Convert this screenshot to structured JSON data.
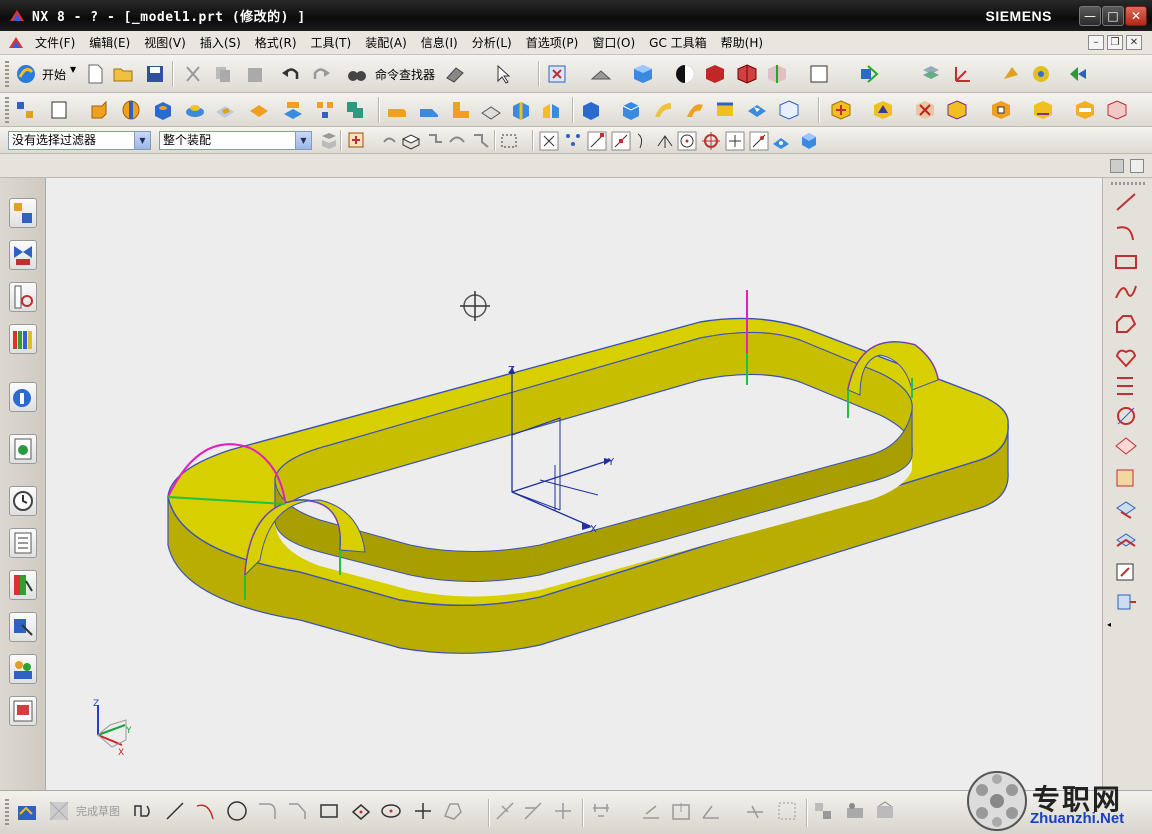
{
  "window": {
    "title": "NX 8 - ? - [_model1.prt  (修改的) ]",
    "brand": "SIEMENS",
    "buttons": {
      "minimize": "—",
      "maximize": "□",
      "close": "✕"
    }
  },
  "menu": {
    "items": [
      "文件(F)",
      "编辑(E)",
      "视图(V)",
      "插入(S)",
      "格式(R)",
      "工具(T)",
      "装配(A)",
      "信息(I)",
      "分析(L)",
      "首选项(P)",
      "窗口(O)",
      "GC 工具箱",
      "帮助(H)"
    ]
  },
  "toolbar": {
    "start_label": "开始",
    "command_finder_label": "命令查找器"
  },
  "filter": {
    "selection_filter": "没有选择过滤器",
    "scope": "整个装配"
  },
  "sketch": {
    "finish_label": "完成草图"
  },
  "viewport": {
    "triad_labels": {
      "z": "Z",
      "y": "Y",
      "x": "X"
    }
  },
  "watermark": {
    "text": "专职网",
    "url": "Zhuanzhi.Net"
  },
  "colors": {
    "body": "#d8cf00",
    "body_dark": "#a39a00",
    "edge": "#3a52b8",
    "arc": "#e020c0",
    "datum": "#6e6e4a",
    "graphics_bg": "#ededed"
  }
}
